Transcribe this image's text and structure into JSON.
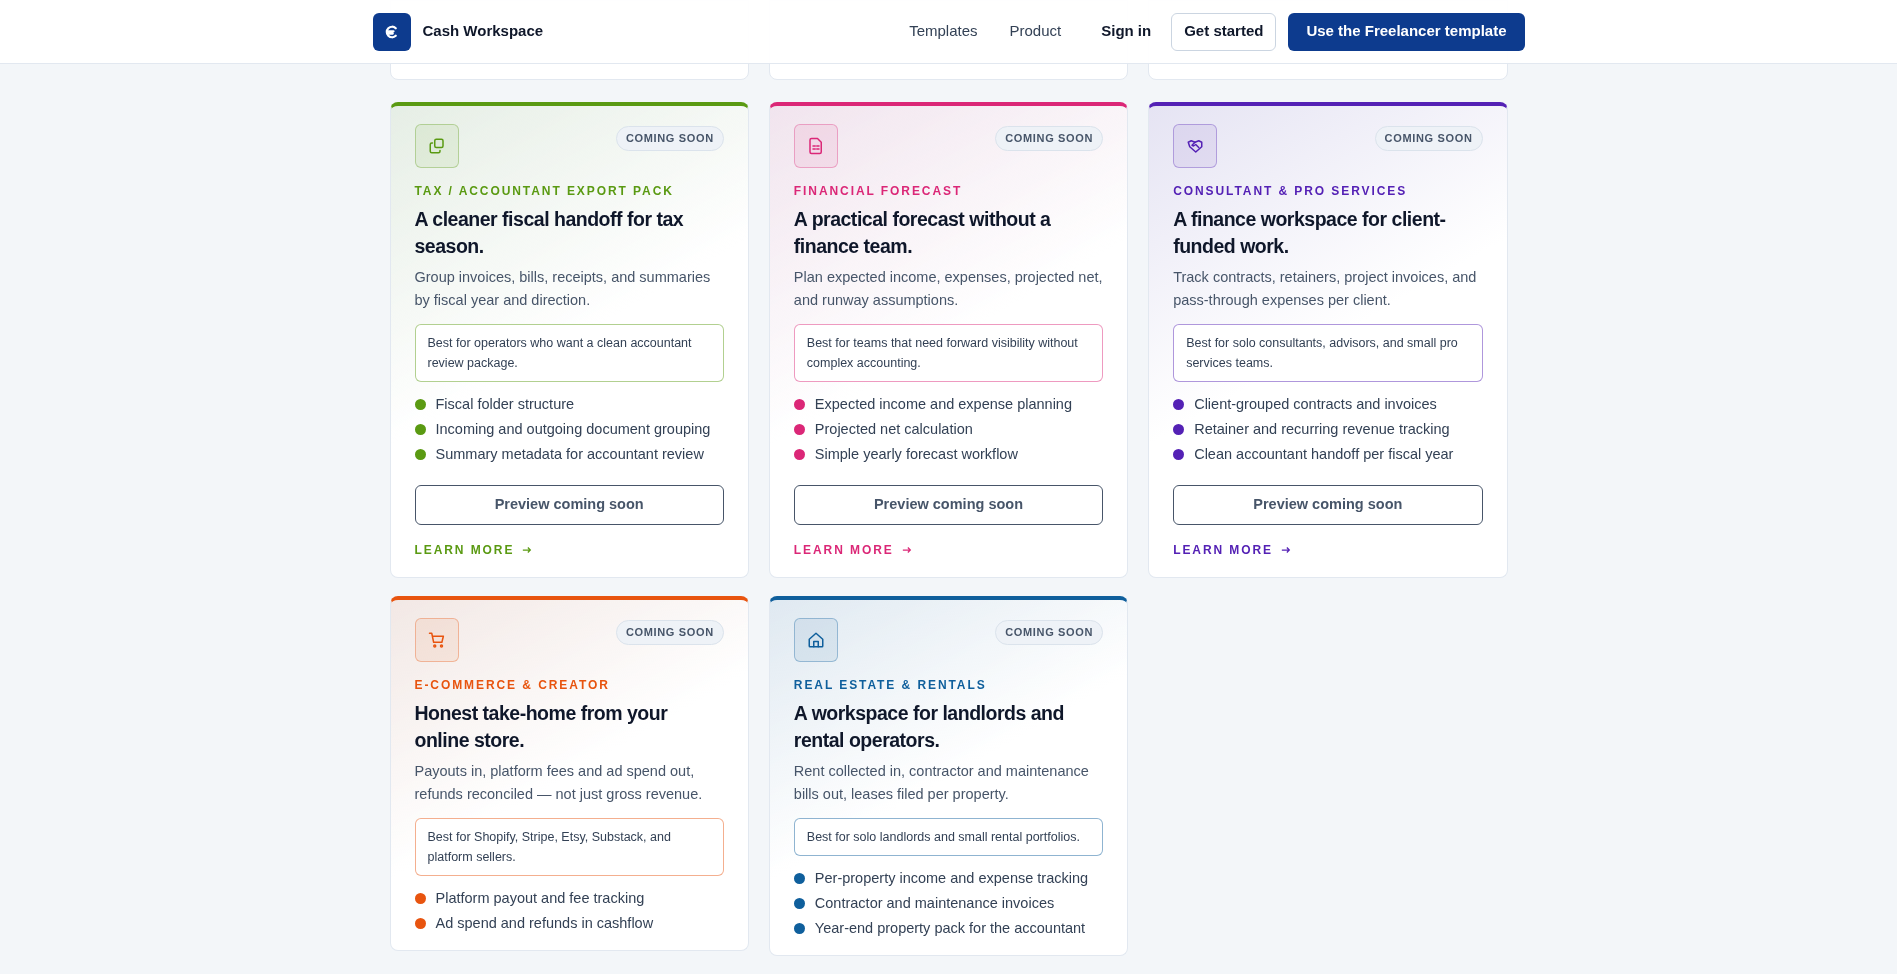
{
  "header": {
    "brand": "Cash Workspace",
    "nav": [
      {
        "label": "Templates"
      },
      {
        "label": "Product"
      }
    ],
    "sign_in": "Sign in",
    "get_started": "Get started",
    "cta": "Use the Freelancer template"
  },
  "cards": [
    {
      "color": "#5a9a12",
      "badge": "COMING SOON",
      "category": "TAX / ACCOUNTANT EXPORT PACK",
      "title": "A cleaner fiscal handoff for tax season.",
      "description": "Group invoices, bills, receipts, and summaries by fiscal year and direction.",
      "best_for": "Best for operators who want a clean accountant review package.",
      "features": [
        "Fiscal folder structure",
        "Incoming and outgoing document grouping",
        "Summary metadata for accountant review"
      ],
      "button": "Preview coming soon",
      "link": "LEARN MORE"
    },
    {
      "color": "#db2777",
      "badge": "COMING SOON",
      "category": "FINANCIAL FORECAST",
      "title": "A practical forecast without a finance team.",
      "description": "Plan expected income, expenses, projected net, and runway assumptions.",
      "best_for": "Best for teams that need forward visibility without complex accounting.",
      "features": [
        "Expected income and expense planning",
        "Projected net calculation",
        "Simple yearly forecast workflow"
      ],
      "button": "Preview coming soon",
      "link": "LEARN MORE"
    },
    {
      "color": "#5421b5",
      "badge": "COMING SOON",
      "category": "CONSULTANT & PRO SERVICES",
      "title": "A finance workspace for client-funded work.",
      "description": "Track contracts, retainers, project invoices, and pass-through expenses per client.",
      "best_for": "Best for solo consultants, advisors, and small pro services teams.",
      "features": [
        "Client-grouped contracts and invoices",
        "Retainer and recurring revenue tracking",
        "Clean accountant handoff per fiscal year"
      ],
      "button": "Preview coming soon",
      "link": "LEARN MORE"
    },
    {
      "color": "#e8540f",
      "badge": "COMING SOON",
      "category": "E-COMMERCE & CREATOR",
      "title": "Honest take-home from your online store.",
      "description": "Payouts in, platform fees and ad spend out, refunds reconciled — not just gross revenue.",
      "best_for": "Best for Shopify, Stripe, Etsy, Substack, and platform sellers.",
      "features": [
        "Platform payout and fee tracking",
        "Ad spend and refunds in cashflow"
      ]
    },
    {
      "color": "#0f5f9c",
      "badge": "COMING SOON",
      "category": "REAL ESTATE & RENTALS",
      "title": "A workspace for landlords and rental operators.",
      "description": "Rent collected in, contractor and maintenance bills out, leases filed per property.",
      "best_for": "Best for solo landlords and small rental portfolios.",
      "features": [
        "Per-property income and expense tracking",
        "Contractor and maintenance invoices",
        "Year-end property pack for the accountant"
      ]
    }
  ]
}
